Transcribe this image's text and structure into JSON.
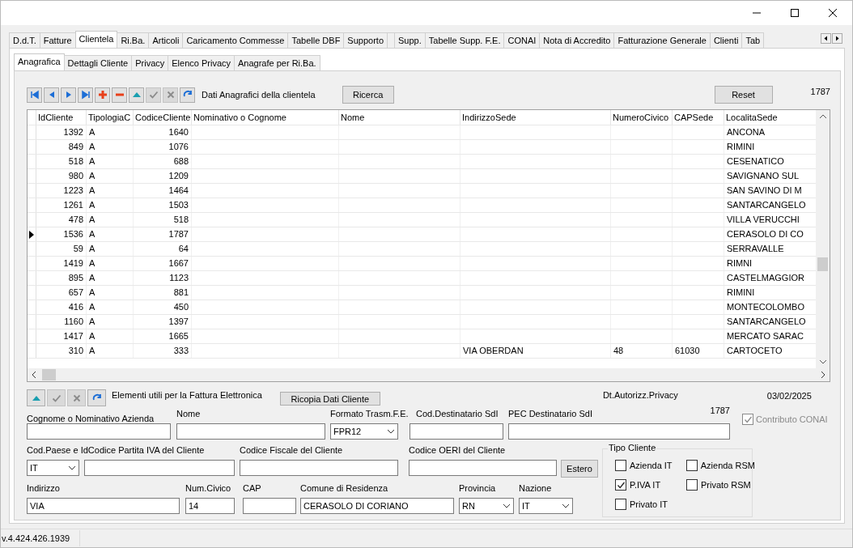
{
  "tabs": [
    {
      "label": "D.d.T.",
      "selected": false
    },
    {
      "label": "Fatture",
      "selected": false
    },
    {
      "label": "Clientela",
      "selected": true
    },
    {
      "label": "Ri.Ba.",
      "selected": false
    },
    {
      "label": "Articoli",
      "selected": false
    },
    {
      "label": "Caricamento Commesse",
      "selected": false
    },
    {
      "label": "Tabelle DBF",
      "selected": false
    },
    {
      "label": "Supporto",
      "selected": false
    },
    {
      "selected": false
    },
    {
      "label": "Supp.",
      "selected": false
    },
    {
      "label": "Tabelle Supp. F.E.",
      "selected": false
    },
    {
      "label": "CONAI",
      "selected": false
    },
    {
      "label": "Nota di Accredito",
      "selected": false
    },
    {
      "label": "Fatturazione Generale",
      "selected": false
    },
    {
      "label": "Clienti",
      "selected": false
    },
    {
      "label": "Tab",
      "selected": false
    }
  ],
  "subtabs": [
    {
      "label": "Anagrafica",
      "selected": true
    },
    {
      "label": "Dettagli Cliente",
      "selected": false
    },
    {
      "label": "Privacy",
      "selected": false
    },
    {
      "label": "Elenco Privacy",
      "selected": false
    },
    {
      "label": "Anagrafe per Ri.Ba.",
      "selected": false
    }
  ],
  "toolbar": {
    "buttons": [
      {
        "kind": "first",
        "disabled": false
      },
      {
        "kind": "prev",
        "disabled": false
      },
      {
        "kind": "next",
        "disabled": false
      },
      {
        "kind": "last",
        "disabled": false
      },
      {
        "kind": "add",
        "disabled": false
      },
      {
        "kind": "delete",
        "disabled": false
      },
      {
        "kind": "edit",
        "disabled": false
      },
      {
        "kind": "confirm",
        "disabled": true
      },
      {
        "kind": "cancel",
        "disabled": true
      },
      {
        "kind": "refresh",
        "disabled": false
      }
    ],
    "caption": "Dati Anagrafici della clientela",
    "search_button": "Ricerca",
    "reset_button": "Reset",
    "record": "1787"
  },
  "grid": {
    "columns": [
      {
        "label": "IdCliente"
      },
      {
        "label": "TipologiaC"
      },
      {
        "label": "CodiceCliente"
      },
      {
        "label": "Nominativo o Cognome"
      },
      {
        "label": "Nome"
      },
      {
        "label": "IndirizzoSede"
      },
      {
        "label": "NumeroCivico"
      },
      {
        "label": "CAPSede"
      },
      {
        "label": "LocalitaSede"
      }
    ],
    "rows": [
      {
        "selected": false,
        "id": "1392",
        "tipologia": "A",
        "codice": "1640",
        "localita": "ANCONA"
      },
      {
        "selected": false,
        "id": "849",
        "tipologia": "A",
        "codice": "1076",
        "localita": "RIMINI"
      },
      {
        "selected": false,
        "id": "518",
        "tipologia": "A",
        "codice": "688",
        "localita": "CESENATICO"
      },
      {
        "selected": false,
        "id": "980",
        "tipologia": "A",
        "codice": "1209",
        "localita": "SAVIGNANO SUL"
      },
      {
        "selected": false,
        "id": "1223",
        "tipologia": "A",
        "codice": "1464",
        "localita": "SAN SAVINO DI M"
      },
      {
        "selected": false,
        "id": "1261",
        "tipologia": "A",
        "codice": "1503",
        "localita": "SANTARCANGELO"
      },
      {
        "selected": false,
        "id": "478",
        "tipologia": "A",
        "codice": "518",
        "localita": "VILLA VERUCCHI"
      },
      {
        "selected": true,
        "id": "1536",
        "tipologia": "A",
        "codice": "1787",
        "localita": "CERASOLO DI CO"
      },
      {
        "selected": false,
        "id": "59",
        "tipologia": "A",
        "codice": "64",
        "localita": "SERRAVALLE"
      },
      {
        "selected": false,
        "id": "1419",
        "tipologia": "A",
        "codice": "1667",
        "localita": "RIMNI"
      },
      {
        "selected": false,
        "id": "895",
        "tipologia": "A",
        "codice": "1123",
        "localita": "CASTELMAGGIOR"
      },
      {
        "selected": false,
        "id": "657",
        "tipologia": "A",
        "codice": "881",
        "localita": "RIMINI"
      },
      {
        "selected": false,
        "id": "416",
        "tipologia": "A",
        "codice": "450",
        "localita": "MONTECOLOMBO"
      },
      {
        "selected": false,
        "id": "1160",
        "tipologia": "A",
        "codice": "1397",
        "localita": "SANTARCANGELO"
      },
      {
        "selected": false,
        "id": "1417",
        "tipologia": "A",
        "codice": "1665",
        "localita": "MERCATO SARAC"
      },
      {
        "selected": false,
        "id": "310",
        "tipologia": "A",
        "codice": "333",
        "indirizzo": "VIA OBERDAN",
        "civico": "48",
        "cap": "61030",
        "localita": "CARTOCETO"
      }
    ]
  },
  "details": {
    "buttons": [
      {
        "kind": "edit",
        "disabled": false
      },
      {
        "kind": "confirm",
        "disabled": true
      },
      {
        "kind": "cancel",
        "disabled": true
      },
      {
        "kind": "refresh",
        "disabled": false
      }
    ],
    "caption": "Elementi utili per la Fattura Elettronica",
    "copy_button": "Ricopia Dati Cliente",
    "privacy_label": "Dt.Autorizz.Privacy",
    "privacy_date": "03/02/2025",
    "record": "1787",
    "conai": {
      "label": "Contributo CONAI",
      "checked": true,
      "disabled": true
    },
    "row_1": [
      {
        "label": "Cognome o Nominativo Azienda",
        "kind": "text"
      },
      {
        "label": "Nome",
        "kind": "text"
      },
      {
        "label": "Formato Trasm.F.E.",
        "kind": "select",
        "value": "FPR12"
      },
      {
        "label": "Cod.Destinatario SdI",
        "kind": "text"
      },
      {
        "label": "PEC Destinatario SdI",
        "kind": "text"
      }
    ],
    "row_2": [
      {
        "label": "Cod.Paese  e IdCodice Partita IVA del Cliente",
        "kind": "select",
        "value": "IT"
      },
      {
        "kind": "text"
      },
      {
        "label": "Codice Fiscale del Cliente",
        "kind": "text"
      },
      {
        "label": "Codice OERI del Cliente",
        "kind": "text"
      },
      {
        "label": "Estero",
        "kind": "button"
      }
    ],
    "row_3": [
      {
        "label": "Indirizzo",
        "kind": "text",
        "value": "VIA"
      },
      {
        "label": "Num.Civico",
        "kind": "text",
        "value": "14"
      },
      {
        "label": "CAP",
        "kind": "text"
      },
      {
        "label": "Comune di Residenza",
        "kind": "text",
        "value": "CERASOLO DI CORIANO"
      },
      {
        "label": "Provincia",
        "kind": "select",
        "value": "RN"
      },
      {
        "label": "Nazione",
        "kind": "select",
        "value": "IT"
      }
    ],
    "tipo_cliente": {
      "title": "Tipo Cliente",
      "options": [
        {
          "label": "Azienda IT",
          "checked": false
        },
        {
          "label": "Azienda RSM",
          "checked": false
        },
        {
          "label": "P.IVA IT",
          "checked": true
        },
        {
          "label": "Privato RSM",
          "checked": false
        },
        {
          "label": "Privato IT",
          "checked": false
        }
      ]
    }
  },
  "status_bar": {
    "version": "v.4.424.426.1939"
  }
}
